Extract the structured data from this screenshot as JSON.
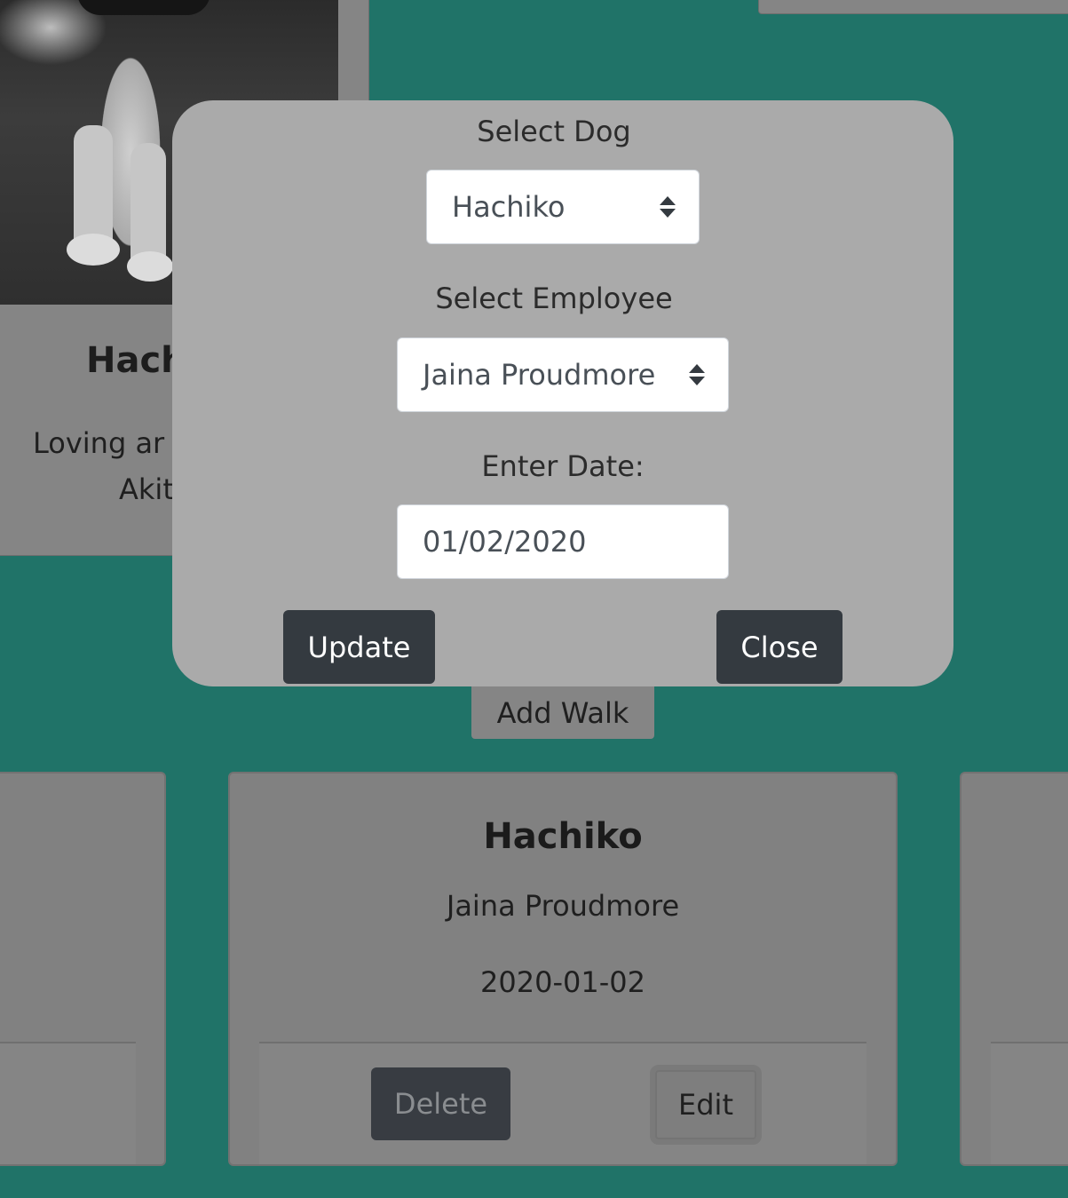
{
  "dog_card": {
    "name_partial": "Hach",
    "description_partial_line1": "Loving ar",
    "description_partial_line2": "Akit"
  },
  "add_walk_button": "Add Walk",
  "walk_card": {
    "dog_name": "Hachiko",
    "employee": "Jaina Proudmore",
    "date": "2020-01-02",
    "delete_label": "Delete",
    "edit_label": "Edit"
  },
  "modal": {
    "select_dog_label": "Select Dog",
    "selected_dog": "Hachiko",
    "select_employee_label": "Select Employee",
    "selected_employee": "Jaina Proudmore",
    "date_label": "Enter Date:",
    "date_value": "01/02/2020",
    "update_label": "Update",
    "close_label": "Close"
  },
  "colors": {
    "page_background": "#207368",
    "modal_background": "#aaaaaa",
    "dark_button": "#343a40"
  }
}
